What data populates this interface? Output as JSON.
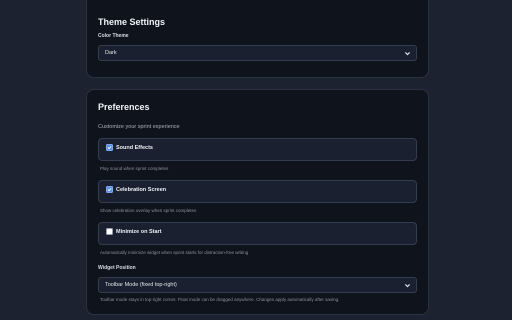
{
  "theme_settings": {
    "title": "Theme Settings",
    "color_theme_label": "Color Theme",
    "color_theme_value": "Dark"
  },
  "preferences": {
    "title": "Preferences",
    "subtitle": "Customize your sprint experience",
    "options": [
      {
        "label": "Sound Effects",
        "checked": true,
        "help": "Play sound when sprint completes"
      },
      {
        "label": "Celebration Screen",
        "checked": true,
        "help": "Show celebration overlay when sprint completes"
      },
      {
        "label": "Minimize on Start",
        "checked": false,
        "help": "Automatically minimize widget when sprint starts for distraction-free writing"
      }
    ],
    "widget_position_label": "Widget Position",
    "widget_position_value": "Toolbar Mode (fixed top-right)",
    "widget_position_help": "Toolbar mode stays in top-right corner, Float mode can be dragged anywhere. Changes apply automatically after saving."
  },
  "colors": {
    "background": "#1c2230",
    "card": "#0f131b",
    "accent": "#5a8fe6"
  }
}
